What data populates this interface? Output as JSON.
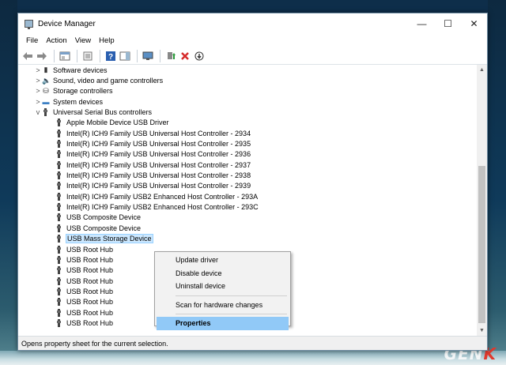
{
  "window": {
    "title": "Device Manager",
    "controls": {
      "minimize": "—",
      "maximize": "☐",
      "close": "✕"
    }
  },
  "menubar": {
    "items": [
      "File",
      "Action",
      "View",
      "Help"
    ]
  },
  "toolbar": {
    "buttons": [
      "back-arrow-icon",
      "forward-arrow-icon",
      "show-hide-console-icon",
      "properties-icon",
      "help-icon",
      "action-pane-icon",
      "monitor-icon",
      "update-driver-icon",
      "uninstall-icon",
      "download-icon"
    ],
    "uninstall_color": "#d62b2b"
  },
  "tree": {
    "categories": [
      {
        "label": "Software devices",
        "expander": ">"
      },
      {
        "label": "Sound, video and game controllers",
        "expander": ">"
      },
      {
        "label": "Storage controllers",
        "expander": ">"
      },
      {
        "label": "System devices",
        "expander": ">"
      },
      {
        "label": "Universal Serial Bus controllers",
        "expander": "v"
      }
    ],
    "usb_devices": [
      "Apple Mobile Device USB Driver",
      "Intel(R) ICH9 Family USB Universal Host Controller - 2934",
      "Intel(R) ICH9 Family USB Universal Host Controller - 2935",
      "Intel(R) ICH9 Family USB Universal Host Controller - 2936",
      "Intel(R) ICH9 Family USB Universal Host Controller - 2937",
      "Intel(R) ICH9 Family USB Universal Host Controller - 2938",
      "Intel(R) ICH9 Family USB Universal Host Controller - 2939",
      "Intel(R) ICH9 Family USB2 Enhanced Host Controller - 293A",
      "Intel(R) ICH9 Family USB2 Enhanced Host Controller - 293C",
      "USB Composite Device",
      "USB Composite Device",
      "USB Mass Storage Device",
      "USB Root Hub",
      "USB Root Hub",
      "USB Root Hub",
      "USB Root Hub",
      "USB Root Hub",
      "USB Root Hub",
      "USB Root Hub",
      "USB Root Hub"
    ],
    "selected_device": "USB Mass Storage Device"
  },
  "context_menu": {
    "update_driver": "Update driver",
    "disable_device": "Disable device",
    "uninstall_device": "Uninstall device",
    "scan": "Scan for hardware changes",
    "properties": "Properties"
  },
  "statusbar": {
    "text": "Opens property sheet for the current selection."
  },
  "watermark": {
    "prefix": "GEN",
    "accent": "K"
  }
}
